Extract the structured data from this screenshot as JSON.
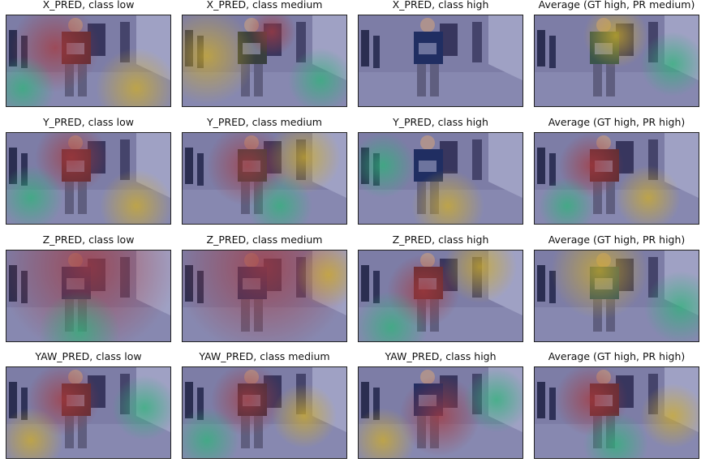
{
  "panels": [
    {
      "title": "X_PRED, class low"
    },
    {
      "title": "X_PRED, class medium"
    },
    {
      "title": "X_PRED, class high"
    },
    {
      "title": "Average (GT high, PR medium)"
    },
    {
      "title": "Y_PRED, class low"
    },
    {
      "title": "Y_PRED, class medium"
    },
    {
      "title": "Y_PRED, class high"
    },
    {
      "title": "Average (GT high, PR high)"
    },
    {
      "title": "Z_PRED, class low"
    },
    {
      "title": "Z_PRED, class medium"
    },
    {
      "title": "Z_PRED, class high"
    },
    {
      "title": "Average (GT high, PR high)"
    },
    {
      "title": "YAW_PRED, class low"
    },
    {
      "title": "YAW_PRED, class medium"
    },
    {
      "title": "YAW_PRED, class high"
    },
    {
      "title": "Average (GT high, PR high)"
    }
  ],
  "colors": {
    "room_base": "#7c7a99",
    "heat_hot": "#c0392b",
    "heat_warm": "#f1c40f",
    "heat_mid": "#2ecc71",
    "heat_cold": "#2c3e90"
  }
}
